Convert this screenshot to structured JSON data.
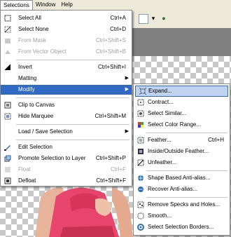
{
  "menubar": {
    "items": [
      {
        "label": "Selections"
      },
      {
        "label": "Window"
      },
      {
        "label": "Help"
      }
    ]
  },
  "selections_menu": {
    "items": [
      {
        "label": "Select All",
        "shortcut": "Ctrl+A"
      },
      {
        "label": "Select None",
        "shortcut": "Ctrl+D"
      },
      {
        "label": "From Mask",
        "shortcut": "Ctrl+Shift+S"
      },
      {
        "label": "From Vector Object",
        "shortcut": "Ctrl+Shift+B"
      },
      {
        "label": "Invert",
        "shortcut": "Ctrl+Shift+I"
      },
      {
        "label": "Matting",
        "shortcut": ""
      },
      {
        "label": "Modify",
        "shortcut": ""
      },
      {
        "label": "Clip to Canvas",
        "shortcut": ""
      },
      {
        "label": "Hide Marquee",
        "shortcut": "Ctrl+Shift+M"
      },
      {
        "label": "Load / Save Selection",
        "shortcut": ""
      },
      {
        "label": "Edit Selection",
        "shortcut": ""
      },
      {
        "label": "Promote Selection to Layer",
        "shortcut": "Ctrl+Shift+P"
      },
      {
        "label": "Float",
        "shortcut": "Ctrl+F"
      },
      {
        "label": "Defloat",
        "shortcut": "Ctrl+Shift+F"
      }
    ]
  },
  "modify_submenu": {
    "items": [
      {
        "label": "Expand...",
        "shortcut": ""
      },
      {
        "label": "Contract...",
        "shortcut": ""
      },
      {
        "label": "Select Similar...",
        "shortcut": ""
      },
      {
        "label": "Select Color Range...",
        "shortcut": ""
      },
      {
        "label": "Feather...",
        "shortcut": "Ctrl+H"
      },
      {
        "label": "Inside/Outside Feather...",
        "shortcut": ""
      },
      {
        "label": "Unfeather...",
        "shortcut": ""
      },
      {
        "label": "Shape Based Anti-alias...",
        "shortcut": ""
      },
      {
        "label": "Recover Anti-alias...",
        "shortcut": ""
      },
      {
        "label": "Remove Specks and Holes...",
        "shortcut": ""
      },
      {
        "label": "Smooth...",
        "shortcut": ""
      },
      {
        "label": "Select Selection Borders...",
        "shortcut": ""
      }
    ]
  },
  "colors": {
    "highlight": "#316ac5",
    "submenu_highlight": "#c1d2ee",
    "disabled_text": "#a0a0a0"
  }
}
